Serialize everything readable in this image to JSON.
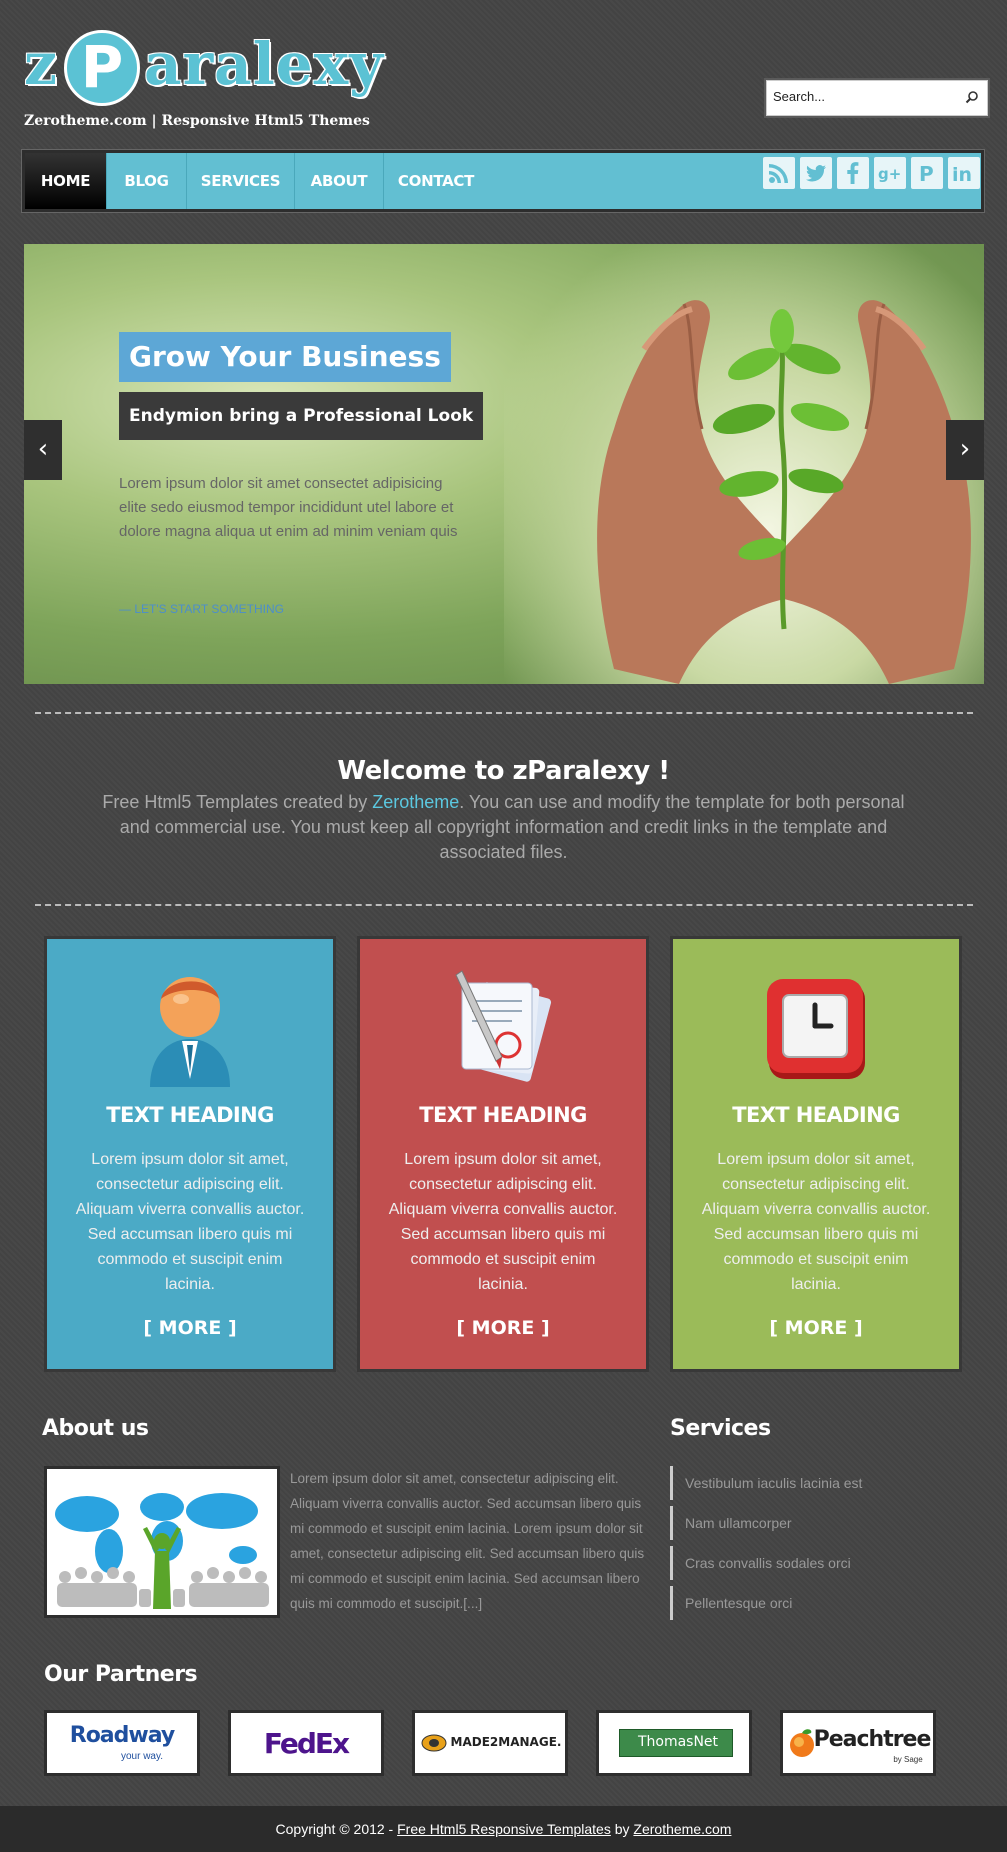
{
  "header": {
    "logo": {
      "z": "z",
      "p": "P",
      "rest": "aralexy"
    },
    "tagline": "Zerotheme.com | Responsive Html5 Themes",
    "search_placeholder": "Search..."
  },
  "nav": {
    "items": [
      {
        "label": "HOME"
      },
      {
        "label": "BLOG"
      },
      {
        "label": "SERVICES"
      },
      {
        "label": "ABOUT"
      },
      {
        "label": "CONTACT"
      }
    ],
    "social": [
      "rss-icon",
      "twitter-icon",
      "facebook-icon",
      "googleplus-icon",
      "pinterest-icon",
      "linkedin-icon"
    ]
  },
  "slider": {
    "title": "Grow Your Business",
    "subtitle": "Endymion bring a Professional Look",
    "text": "Lorem ipsum dolor sit amet consectet adipisicing elite sedo eiusmod tempor incididunt utel labore et dolore magna aliqua ut enim ad minim veniam quis",
    "cta": "— LET'S START SOMETHING",
    "prev": "‹",
    "next": "›"
  },
  "welcome": {
    "title": "Welcome to zParalexy !",
    "text_before": "Free Html5 Templates created by ",
    "link": "Zerotheme",
    "text_after": ". You can use and modify the template for both personal and commercial use. You must keep all copyright information and credit links in the template and associated files."
  },
  "features": [
    {
      "heading": "TEXT HEADING",
      "text": "Lorem ipsum dolor sit amet, consectetur adipiscing elit. Aliquam viverra convallis auctor. Sed accumsan libero quis mi commodo et suscipit enim lacinia.",
      "more": "[ MORE ]",
      "color": "#4baac6",
      "icon": "user-icon"
    },
    {
      "heading": "TEXT HEADING",
      "text": "Lorem ipsum dolor sit amet, consectetur adipiscing elit. Aliquam viverra convallis auctor. Sed accumsan libero quis mi commodo et suscipit enim lacinia.",
      "more": "[ MORE ]",
      "color": "#c14f4f",
      "icon": "document-pen-icon"
    },
    {
      "heading": "TEXT HEADING",
      "text": "Lorem ipsum dolor sit amet, consectetur adipiscing elit. Aliquam viverra convallis auctor. Sed accumsan libero quis mi commodo et suscipit enim lacinia.",
      "more": "[ MORE ]",
      "color": "#9bbb59",
      "icon": "clock-icon"
    }
  ],
  "about": {
    "heading": "About us",
    "text": "Lorem ipsum dolor sit amet, consectetur adipiscing elit. Aliquam viverra convallis auctor. Sed accumsan libero quis mi commodo et suscipit enim lacinia. Lorem ipsum dolor sit amet, consectetur adipiscing elit. Sed accumsan libero quis mi commodo et suscipit enim lacinia. Sed accumsan libero quis mi commodo et suscipit.[...]"
  },
  "services": {
    "heading": "Services",
    "items": [
      "Vestibulum iaculis lacinia est",
      "Nam ullamcorper",
      "Cras convallis sodales orci",
      "Pellentesque orci"
    ]
  },
  "partners": {
    "heading": "Our Partners",
    "items": [
      {
        "name": "Roadway",
        "sub": "your way."
      },
      {
        "name": "FedEx",
        "sub": ""
      },
      {
        "name": "MADE2MANAGE.",
        "sub": ""
      },
      {
        "name": "ThomasNet",
        "sub": ""
      },
      {
        "name": "Peachtree",
        "sub": "by Sage"
      }
    ]
  },
  "footer": {
    "prefix": "Copyright © 2012 - ",
    "link1": "Free Html5 Responsive Templates",
    "middle": " by ",
    "link2": "Zerotheme.com"
  }
}
